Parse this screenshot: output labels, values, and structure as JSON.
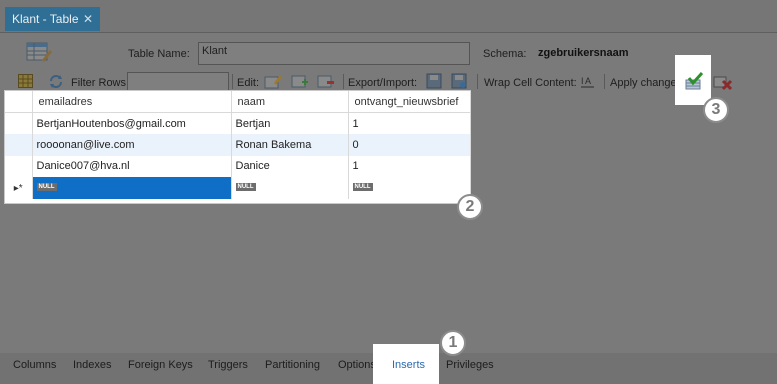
{
  "tab": {
    "title": "Klant - Table",
    "close": "✕"
  },
  "form": {
    "table_name_label": "Table Name:",
    "table_name_value": "Klant",
    "schema_label": "Schema:",
    "schema_value": "zgebruikersnaam"
  },
  "toolbar": {
    "filter_label": "Filter Rows:",
    "edit_label": "Edit:",
    "export_label": "Export/Import:",
    "wrap_label": "Wrap Cell Content:",
    "apply_label": "Apply changes:"
  },
  "grid": {
    "columns": [
      "emailadres",
      "naam",
      "ontvangt_nieuwsbrief"
    ],
    "rows": [
      [
        "BertjanHoutenbos@gmail.com",
        "Bertjan",
        "1"
      ],
      [
        "roooonan@live.com",
        "Ronan Bakema",
        "0"
      ],
      [
        "Danice007@hva.nl",
        "Danice",
        "1"
      ]
    ],
    "null_badge": "NULL",
    "new_row_marker": "▸*"
  },
  "callouts": {
    "one": "1",
    "two": "2",
    "three": "3"
  },
  "bottom_tabs": [
    "Columns",
    "Indexes",
    "Foreign Keys",
    "Triggers",
    "Partitioning",
    "Options",
    "Inserts",
    "Privileges"
  ],
  "colors": {
    "tab_blue": "#2f6f95",
    "selected_cell": "#0f6fc6",
    "active_tab_text": "#2a6ab0"
  }
}
